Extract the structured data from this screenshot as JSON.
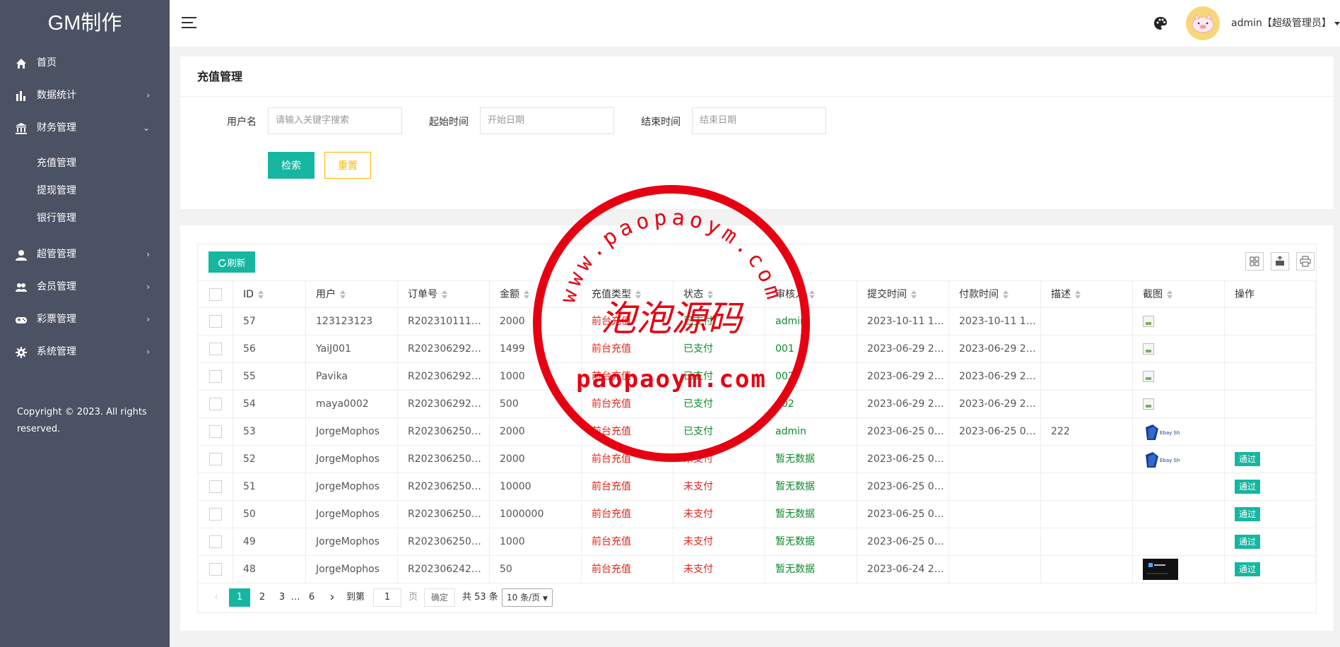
{
  "sidebar": {
    "logo": "GM制作",
    "items": [
      {
        "label": "首页",
        "icon": "home-icon"
      },
      {
        "label": "数据统计",
        "icon": "bar-chart-icon",
        "arrow": "›"
      },
      {
        "label": "财务管理",
        "icon": "bank-icon",
        "arrow": "⌄"
      }
    ],
    "finance_sub": [
      "充值管理",
      "提现管理",
      "银行管理"
    ],
    "items2": [
      {
        "label": "超管管理",
        "icon": "user-icon",
        "arrow": "›"
      },
      {
        "label": "会员管理",
        "icon": "users-icon",
        "arrow": "›"
      },
      {
        "label": "彩票管理",
        "icon": "gamepad-icon",
        "arrow": "›"
      },
      {
        "label": "系统管理",
        "icon": "gear-icon",
        "arrow": "›"
      }
    ],
    "copyright": "Copyright © 2023. All rights reserved."
  },
  "header": {
    "user_label": "admin【超级管理员】"
  },
  "search": {
    "title": "充值管理",
    "username_label": "用户名",
    "username_placeholder": "请输入关键字搜索",
    "start_label": "起始时间",
    "start_placeholder": "开始日期",
    "end_label": "结束时间",
    "end_placeholder": "结束日期",
    "search_button": "检索",
    "reset_button": "重置"
  },
  "table": {
    "refresh_button": "刷新",
    "columns": [
      "ID",
      "用户",
      "订单号",
      "金额",
      "充值类型",
      "状态",
      "审核人",
      "提交时间",
      "付款时间",
      "描述",
      "截图",
      "操作"
    ],
    "rows": [
      {
        "id": "57",
        "user": "123123123",
        "order": "R202310111…",
        "amount": "2000",
        "type": "前台充值",
        "status": "已支付",
        "reviewer": "admin",
        "submit": "2023-10-11 1…",
        "paid": "2023-10-11 1…",
        "desc": "",
        "shot": "broken",
        "action": ""
      },
      {
        "id": "56",
        "user": "YaiJ001",
        "order": "R202306292…",
        "amount": "1499",
        "type": "前台充值",
        "status": "已支付",
        "reviewer": "001",
        "submit": "2023-06-29 2…",
        "paid": "2023-06-29 2…",
        "desc": "",
        "shot": "broken",
        "action": ""
      },
      {
        "id": "55",
        "user": "Pavika",
        "order": "R202306292…",
        "amount": "1000",
        "type": "前台充值",
        "status": "已支付",
        "reviewer": "002",
        "submit": "2023-06-29 2…",
        "paid": "2023-06-29 2…",
        "desc": "",
        "shot": "broken",
        "action": ""
      },
      {
        "id": "54",
        "user": "maya0002",
        "order": "R202306292…",
        "amount": "500",
        "type": "前台充值",
        "status": "已支付",
        "reviewer": "002",
        "submit": "2023-06-29 2…",
        "paid": "2023-06-29 2…",
        "desc": "",
        "shot": "broken",
        "action": ""
      },
      {
        "id": "53",
        "user": "JorgeMophos",
        "order": "R202306250…",
        "amount": "2000",
        "type": "前台充值",
        "status": "已支付",
        "reviewer": "admin",
        "submit": "2023-06-25 0…",
        "paid": "2023-06-25 0…",
        "desc": "222",
        "shot": "logo",
        "action": ""
      },
      {
        "id": "52",
        "user": "JorgeMophos",
        "order": "R202306250…",
        "amount": "2000",
        "type": "前台充值",
        "status": "未支付",
        "reviewer": "暂无数据",
        "submit": "2023-06-25 0…",
        "paid": "",
        "desc": "",
        "shot": "logo",
        "action": "通过"
      },
      {
        "id": "51",
        "user": "JorgeMophos",
        "order": "R202306250…",
        "amount": "10000",
        "type": "前台充值",
        "status": "未支付",
        "reviewer": "暂无数据",
        "submit": "2023-06-25 0…",
        "paid": "",
        "desc": "",
        "shot": "",
        "action": "通过"
      },
      {
        "id": "50",
        "user": "JorgeMophos",
        "order": "R202306250…",
        "amount": "1000000",
        "type": "前台充值",
        "status": "未支付",
        "reviewer": "暂无数据",
        "submit": "2023-06-25 0…",
        "paid": "",
        "desc": "",
        "shot": "",
        "action": "通过"
      },
      {
        "id": "49",
        "user": "JorgeMophos",
        "order": "R202306250…",
        "amount": "1000",
        "type": "前台充值",
        "status": "未支付",
        "reviewer": "暂无数据",
        "submit": "2023-06-25 0…",
        "paid": "",
        "desc": "",
        "shot": "",
        "action": "通过"
      },
      {
        "id": "48",
        "user": "JorgeMophos",
        "order": "R202306242…",
        "amount": "50",
        "type": "前台充值",
        "status": "未支付",
        "reviewer": "暂无数据",
        "submit": "2023-06-24 2…",
        "paid": "",
        "desc": "",
        "shot": "dark",
        "action": "通过"
      }
    ]
  },
  "pagination": {
    "pages": [
      "1",
      "2",
      "3",
      "…",
      "6"
    ],
    "goto_label": "到第",
    "goto_value": "1",
    "page_unit": "页",
    "confirm": "确定",
    "total": "共 53 条",
    "page_size": "10 条/页"
  },
  "watermark": {
    "ring_text": "www.paopaoym.com",
    "center_text": "泡泡源码",
    "bottom_text": "paopaoym.com"
  },
  "colors": {
    "sidebar": "#4a5263",
    "primary": "#16b6a0",
    "warning": "#ffb800",
    "red": "#e1251b",
    "green": "#0e8a2a"
  }
}
